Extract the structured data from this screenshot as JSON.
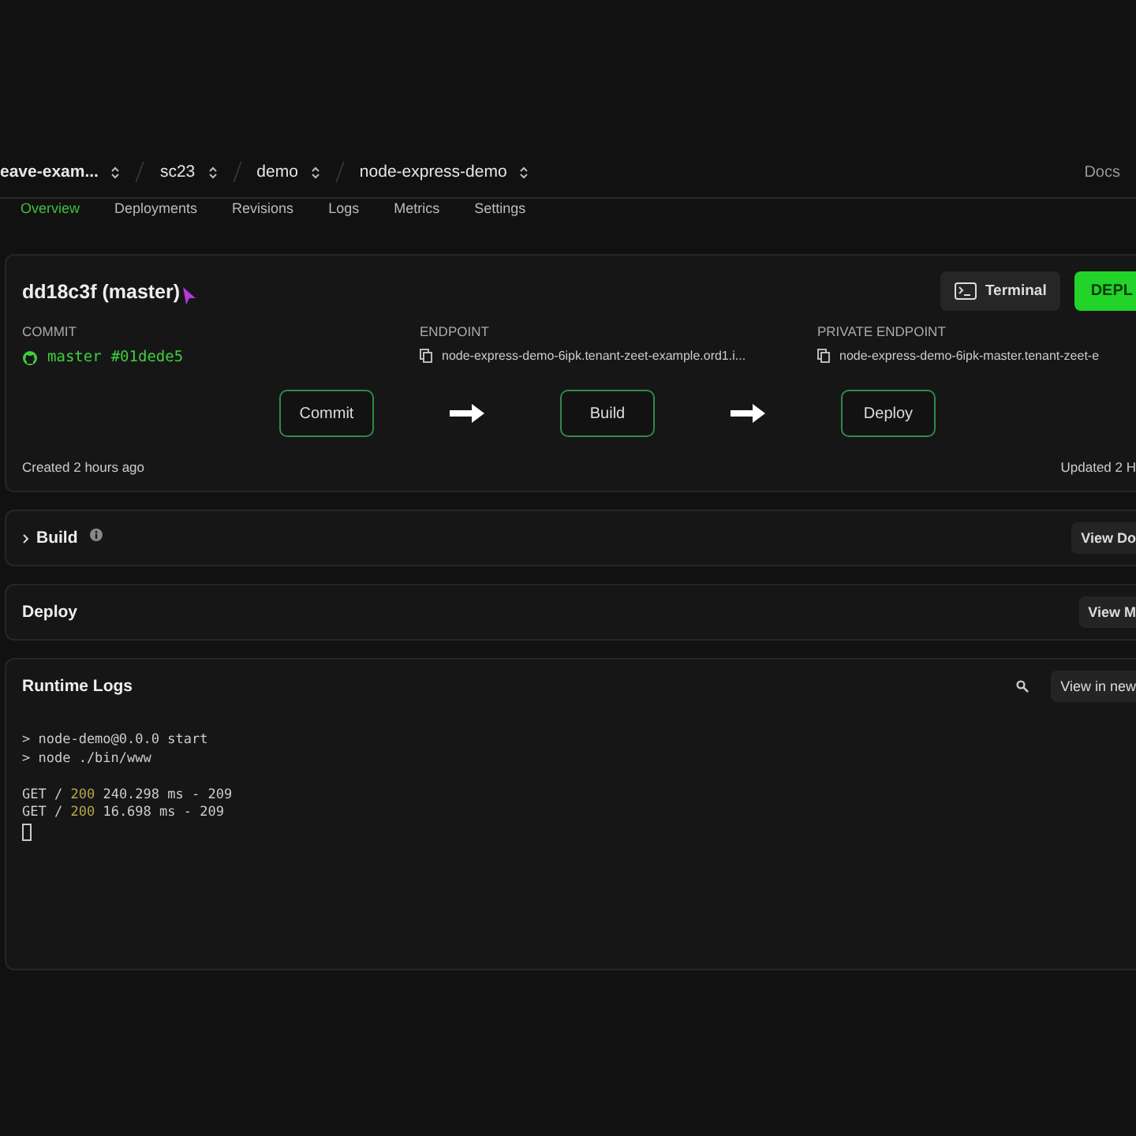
{
  "breadcrumb": [
    {
      "label": "eave-exam..."
    },
    {
      "label": "sc23"
    },
    {
      "label": "demo"
    },
    {
      "label": "node-express-demo"
    }
  ],
  "docs_link": "Docs",
  "tabs": [
    {
      "label": "Overview",
      "selected": true
    },
    {
      "label": "Deployments",
      "selected": false
    },
    {
      "label": "Revisions",
      "selected": false
    },
    {
      "label": "Logs",
      "selected": false
    },
    {
      "label": "Metrics",
      "selected": false
    },
    {
      "label": "Settings",
      "selected": false
    }
  ],
  "deployment": {
    "title": "dd18c3f (master)",
    "terminal_button": "Terminal",
    "deploy_button": "DEPL",
    "commit": {
      "label": "COMMIT",
      "branch": "master",
      "hash": "#01dede5"
    },
    "endpoint": {
      "label": "ENDPOINT",
      "value": "node-express-demo-6ipk.tenant-zeet-example.ord1.i..."
    },
    "private_endpoint": {
      "label": "PRIVATE ENDPOINT",
      "value": "node-express-demo-6ipk-master.tenant-zeet-e"
    },
    "pipeline": [
      "Commit",
      "Build",
      "Deploy"
    ],
    "created": "Created 2 hours ago",
    "updated": "Updated 2 H"
  },
  "sections": [
    {
      "title": "Build",
      "expandable": true,
      "info": true,
      "button": "View Do"
    },
    {
      "title": "Deploy",
      "expandable": false,
      "info": false,
      "button": "View M"
    }
  ],
  "runtime_logs": {
    "title": "Runtime Logs",
    "button": "View in new",
    "lines": [
      {
        "kind": "plain",
        "text": "> node-demo@0.0.0 start"
      },
      {
        "kind": "plain",
        "text": "> node ./bin/www"
      },
      {
        "kind": "blank"
      },
      {
        "kind": "request",
        "method": "GET /",
        "status": "200",
        "rest": "240.298 ms - 209"
      },
      {
        "kind": "request",
        "method": "GET /",
        "status": "200",
        "rest": "16.698 ms - 209"
      },
      {
        "kind": "cursor"
      }
    ]
  }
}
